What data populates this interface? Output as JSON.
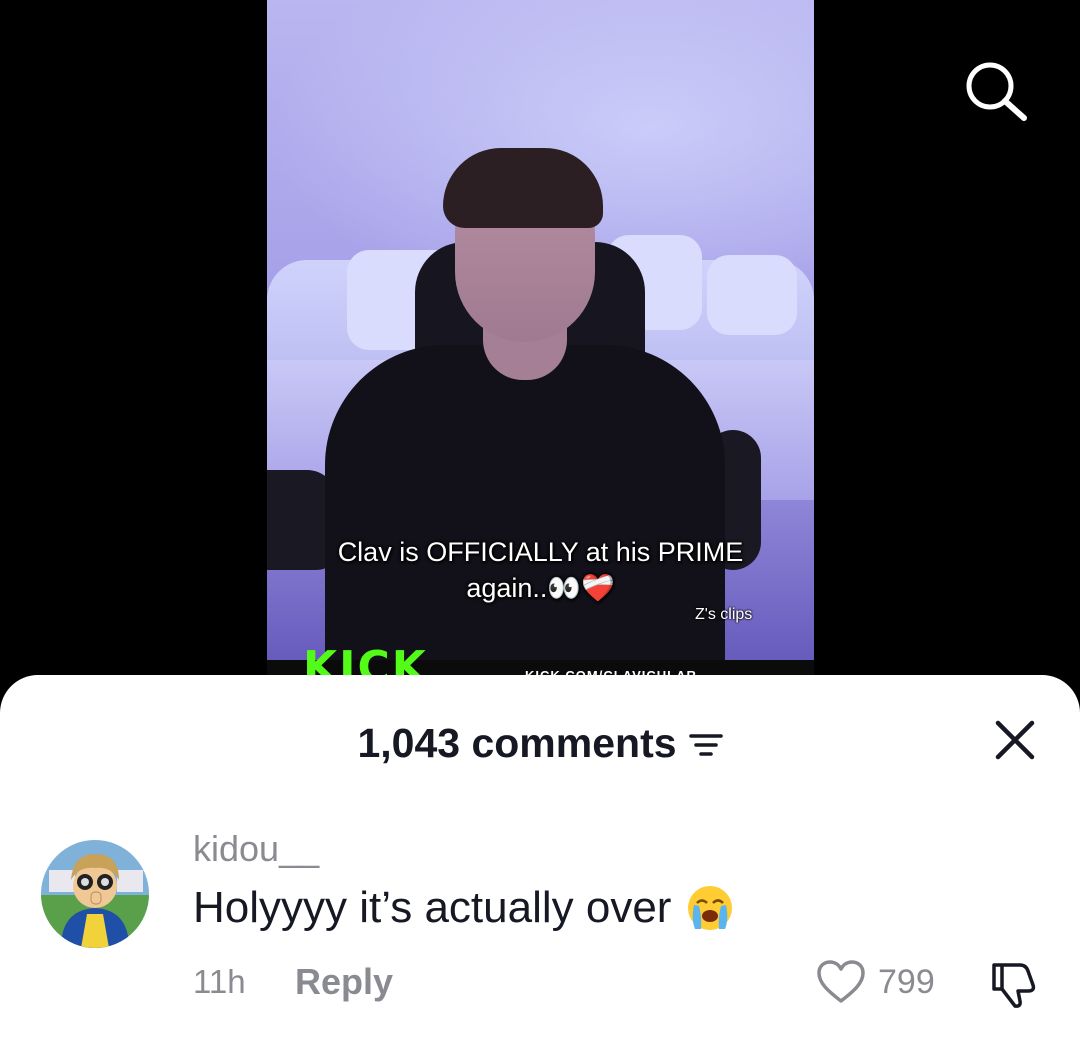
{
  "video": {
    "caption_line1": "Clav is OFFICIALLY at his PRIME",
    "caption_line2": "again..",
    "watermark": "Z's clips",
    "overlay_logo": "KICK",
    "overlay_url": "KICK.COM/CLAVICULAR"
  },
  "topbar": {
    "search_icon": "search-icon"
  },
  "comments": {
    "count_label": "1,043 comments",
    "filter_icon": "filter-icon",
    "close_icon": "close-icon",
    "items": [
      {
        "username": "kidou__",
        "text": "Holyyyy it’s actually over",
        "emoji": "crying-face-icon",
        "time": "11h",
        "reply_label": "Reply",
        "likes": "799"
      }
    ]
  },
  "colors": {
    "sheet_bg": "#ffffff",
    "primary_text": "#161823",
    "secondary_text": "#8a8b91",
    "kick_green": "#53fc18"
  }
}
